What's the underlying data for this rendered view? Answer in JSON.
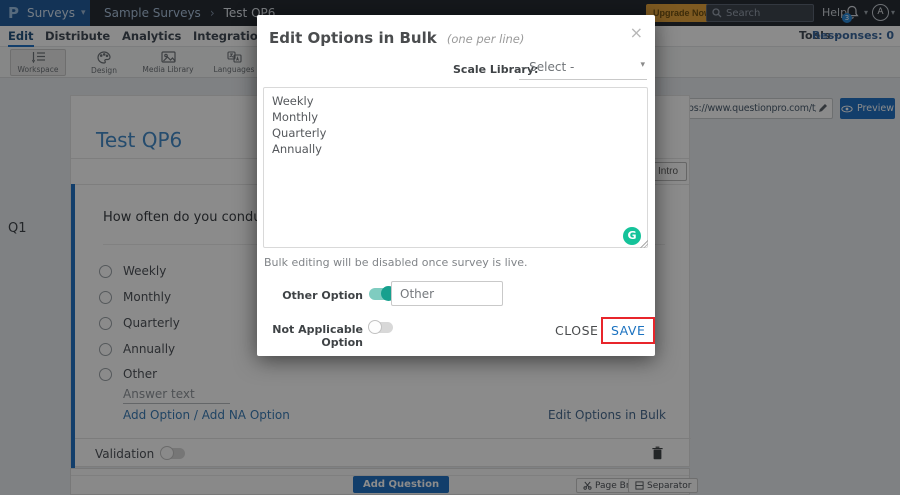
{
  "topbar": {
    "logo": "P",
    "product": "Surveys",
    "caret": "▾",
    "breadcrumb": [
      "Sample Surveys",
      "Test QP6"
    ],
    "breadcrumb_sep": "›",
    "upgrade_label": "Upgrade Now",
    "search_placeholder": "Search",
    "help_label": "Help",
    "bell_badge": "3",
    "avatar_initial": "A"
  },
  "subnav": {
    "tabs": [
      {
        "label": "Edit"
      },
      {
        "label": "Distribute"
      },
      {
        "label": "Analytics"
      },
      {
        "label": "Integration"
      }
    ],
    "tools_label": "Tools",
    "tools_caret": "▾",
    "responses_label": "Responses: 0"
  },
  "toolbar": {
    "items": [
      {
        "label": "Workspace"
      },
      {
        "label": "Design"
      },
      {
        "label": "Media Library"
      },
      {
        "label": "Languages"
      }
    ],
    "url_fragment": "d",
    "url": "https://www.questionpro.com/t/APNrFZ",
    "preview_label": "Preview"
  },
  "survey": {
    "badge": "Q1",
    "title": "Test QP6",
    "intro_label": "Intro",
    "question": "How often do you conduct the",
    "options": [
      "Weekly",
      "Monthly",
      "Quarterly",
      "Annually",
      "Other"
    ],
    "answer_placeholder": "Answer text",
    "add_option": "Add Option",
    "link_sep": " / ",
    "add_na_option": "Add NA Option",
    "edit_bulk": "Edit Options in Bulk",
    "validation_label": "Validation"
  },
  "footer": {
    "add_question": "Add Question",
    "page_break": "Page Break",
    "separator": "Separator"
  },
  "modal": {
    "title": "Edit Options in Bulk",
    "subtitle": "(one per line)",
    "close": "×",
    "scale_label": "Scale Library:",
    "scale_value": "- Select -",
    "scale_caret": "▾",
    "options_text": "Weekly\nMonthly\nQuarterly\nAnnually",
    "grammarly": "G",
    "note": "Bulk editing will be disabled once survey is live.",
    "other_label": "Other Option",
    "other_value": "Other",
    "na_label": "Not Applicable Option",
    "close_label": "CLOSE",
    "save_label": "SAVE"
  },
  "colors": {
    "accent": "#1b6ec2",
    "toggle_on": "#17a08e",
    "grammarly_green": "#15c39a",
    "upgrade_orange": "#e7a338",
    "save_highlight_red": "#e8252b",
    "topbar_blue": "#1d5a9b"
  }
}
